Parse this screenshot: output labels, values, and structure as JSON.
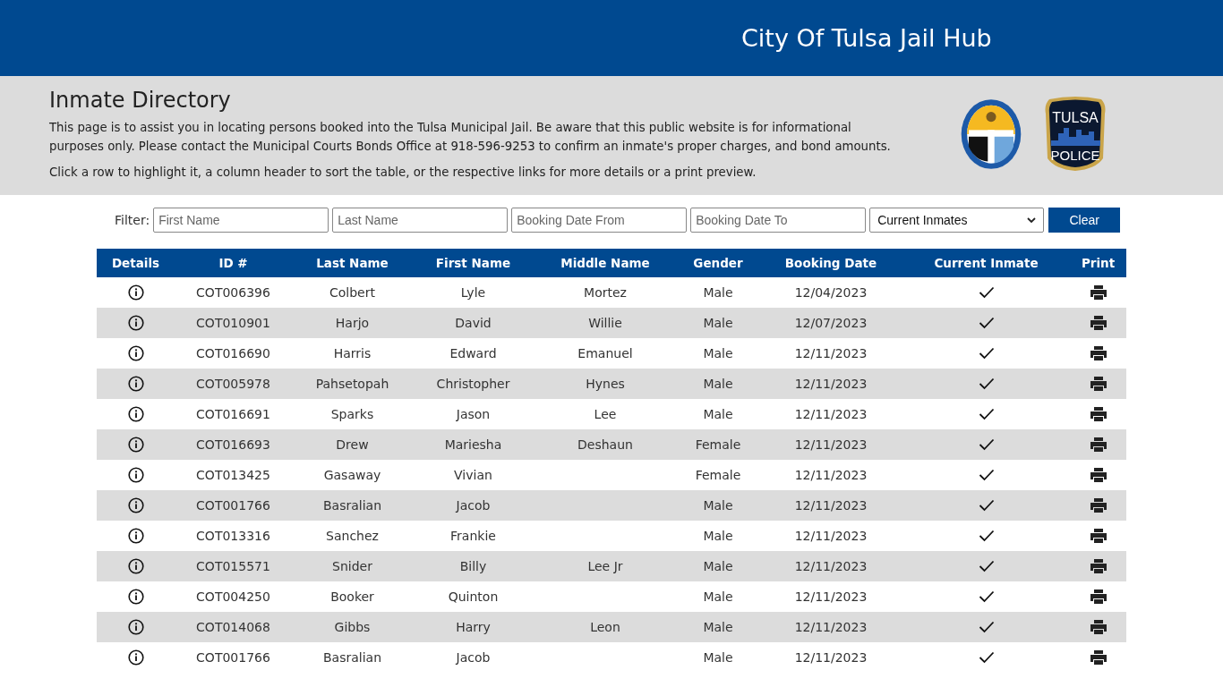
{
  "header": {
    "title": "City Of Tulsa Jail Hub"
  },
  "intro": {
    "heading": "Inmate Directory",
    "paragraphs": [
      "This page is to assist you in locating persons booked into the Tulsa Municipal Jail. Be aware that this public website is for informational purposes only. Please contact the Municipal Courts Bonds Office at 918-596-9253 to confirm an inmate's proper charges, and bond amounts.",
      "Click a row to highlight it, a column header to sort the table, or the respective links for more details or a print preview."
    ],
    "badge": {
      "line_1": "TULSA",
      "line_2": "POLICE"
    }
  },
  "filter": {
    "label": "Filter:",
    "fields": [
      {
        "placeholder": "First Name"
      },
      {
        "placeholder": "Last Name"
      },
      {
        "placeholder": "Booking Date From"
      },
      {
        "placeholder": "Booking Date To"
      }
    ],
    "select": {
      "value": "Current Inmates"
    },
    "button": "Clear"
  },
  "table": {
    "columns": [
      "Details",
      "ID #",
      "Last Name",
      "First Name",
      "Middle Name",
      "Gender",
      "Booking Date",
      "Current Inmate",
      "Print"
    ],
    "rows": [
      {
        "id": "COT006396",
        "last": "Colbert",
        "first": "Lyle",
        "middle": "Mortez",
        "gender": "Male",
        "date": "12/04/2023",
        "current": true
      },
      {
        "id": "COT010901",
        "last": "Harjo",
        "first": "David",
        "middle": "Willie",
        "gender": "Male",
        "date": "12/07/2023",
        "current": true
      },
      {
        "id": "COT016690",
        "last": "Harris",
        "first": "Edward",
        "middle": "Emanuel",
        "gender": "Male",
        "date": "12/11/2023",
        "current": true
      },
      {
        "id": "COT005978",
        "last": "Pahsetopah",
        "first": "Christopher",
        "middle": "Hynes",
        "gender": "Male",
        "date": "12/11/2023",
        "current": true
      },
      {
        "id": "COT016691",
        "last": "Sparks",
        "first": "Jason",
        "middle": "Lee",
        "gender": "Male",
        "date": "12/11/2023",
        "current": true
      },
      {
        "id": "COT016693",
        "last": "Drew",
        "first": "Mariesha",
        "middle": "Deshaun",
        "gender": "Female",
        "date": "12/11/2023",
        "current": true
      },
      {
        "id": "COT013425",
        "last": "Gasaway",
        "first": "Vivian",
        "middle": "",
        "gender": "Female",
        "date": "12/11/2023",
        "current": true
      },
      {
        "id": "COT001766",
        "last": "Basralian",
        "first": "Jacob",
        "middle": "",
        "gender": "Male",
        "date": "12/11/2023",
        "current": true
      },
      {
        "id": "COT013316",
        "last": "Sanchez",
        "first": "Frankie",
        "middle": "",
        "gender": "Male",
        "date": "12/11/2023",
        "current": true
      },
      {
        "id": "COT015571",
        "last": "Snider",
        "first": "Billy",
        "middle": "Lee Jr",
        "gender": "Male",
        "date": "12/11/2023",
        "current": true
      },
      {
        "id": "COT004250",
        "last": "Booker",
        "first": "Quinton",
        "middle": "",
        "gender": "Male",
        "date": "12/11/2023",
        "current": true
      },
      {
        "id": "COT014068",
        "last": "Gibbs",
        "first": "Harry",
        "middle": "Leon",
        "gender": "Male",
        "date": "12/11/2023",
        "current": true
      },
      {
        "id": "COT001766",
        "last": "Basralian",
        "first": "Jacob",
        "middle": "",
        "gender": "Male",
        "date": "12/11/2023",
        "current": true
      }
    ]
  }
}
